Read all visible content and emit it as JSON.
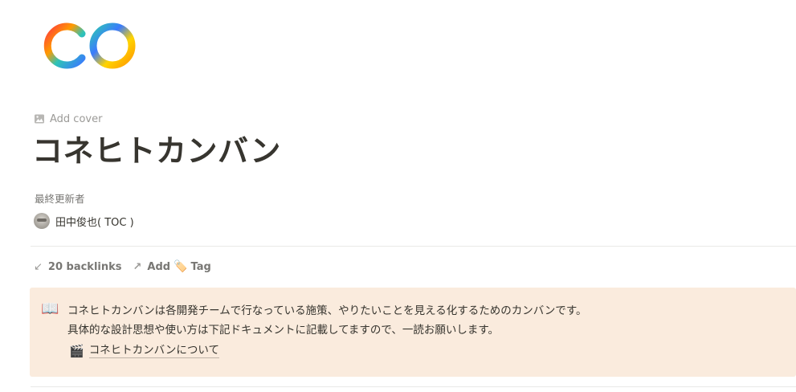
{
  "page_icon": "infinity-ring-icon",
  "add_cover": {
    "label": "Add cover",
    "icon": "image-icon"
  },
  "title": "コネヒトカンバン",
  "properties": {
    "last_edited_by_label": "最終更新者",
    "last_edited_by_value": "田中俊也( TOC )"
  },
  "meta": {
    "backlinks_label": "20 backlinks",
    "add_label": "Add",
    "tag_label": "Tag"
  },
  "callout": {
    "icon": "📖",
    "line1": "コネヒトカンバンは各開発チームで行なっている施策、やりたいことを見える化するためのカンバンです。",
    "line2": "具体的な設計思想や使い方は下記ドキュメントに記載してますので、一読お願いします。",
    "link_icon": "🎬",
    "link_label": "コネヒトカンバンについて"
  },
  "colors": {
    "callout_bg": "#faebdd",
    "text": "#37352f",
    "muted": "#787774"
  }
}
